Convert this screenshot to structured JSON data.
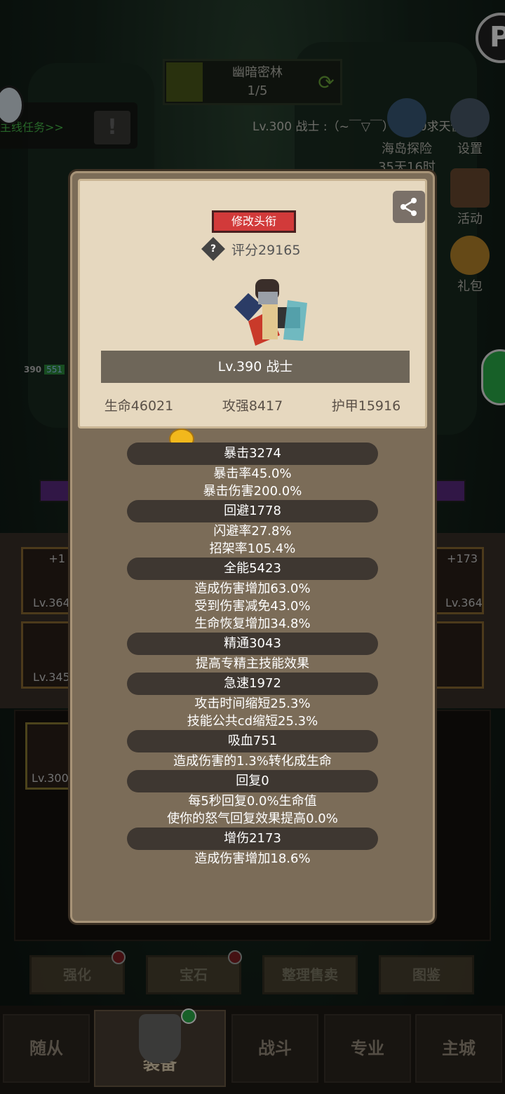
{
  "top": {
    "zone_name": "幽暗密林",
    "zone_progress": "1/5",
    "quest_text": "主线任务>>",
    "broadcast": "Lv.300 战士 :（~￣▽￣）~300求天使",
    "side_menu": [
      {
        "label": "海岛探险",
        "sub": "35天16时",
        "icon": "island-icon"
      },
      {
        "label": "设置",
        "icon": "gear-icon"
      },
      {
        "label": "活动",
        "icon": "scroll-icon"
      },
      {
        "label": "礼包",
        "icon": "gift-icon"
      }
    ],
    "enemy_level": "390",
    "enemy_hp": "551"
  },
  "equip_slots": {
    "left": [
      {
        "plus": "+1",
        "level": "Lv.364"
      },
      {
        "level": "Lv.345"
      }
    ],
    "right": [
      {
        "plus": "+173",
        "level": "Lv.364"
      }
    ],
    "inventory_first": "Lv.300"
  },
  "modal": {
    "title_button": "修改头衔",
    "score": "评分29165",
    "level_class": "Lv.390 战士",
    "base_stats": {
      "hp": "生命46021",
      "atk": "攻强8417",
      "armor": "护甲15916"
    },
    "groups": [
      {
        "header": "暴击3274",
        "lines": [
          "暴击率45.0%",
          "暴击伤害200.0%"
        ]
      },
      {
        "header": "回避1778",
        "lines": [
          "闪避率27.8%",
          "招架率105.4%"
        ]
      },
      {
        "header": "全能5423",
        "lines": [
          "造成伤害增加63.0%",
          "受到伤害减免43.0%",
          "生命恢复增加34.8%"
        ]
      },
      {
        "header": "精通3043",
        "lines": [
          "提高专精主技能效果"
        ]
      },
      {
        "header": "急速1972",
        "lines": [
          "攻击时间缩短25.3%",
          "技能公共cd缩短25.3%"
        ]
      },
      {
        "header": "吸血751",
        "lines": [
          "造成伤害的1.3%转化成生命"
        ]
      },
      {
        "header": "回复0",
        "lines": [
          "每5秒回复0.0%生命值",
          "使你的怒气回复效果提高0.0%"
        ]
      },
      {
        "header": "增伤2173",
        "lines": [
          "造成伤害增加18.6%"
        ]
      }
    ]
  },
  "action_tabs": [
    "强化",
    "宝石",
    "整理售卖",
    "图鉴"
  ],
  "nav": [
    "随从",
    "装备",
    "战斗",
    "专业",
    "主城"
  ]
}
